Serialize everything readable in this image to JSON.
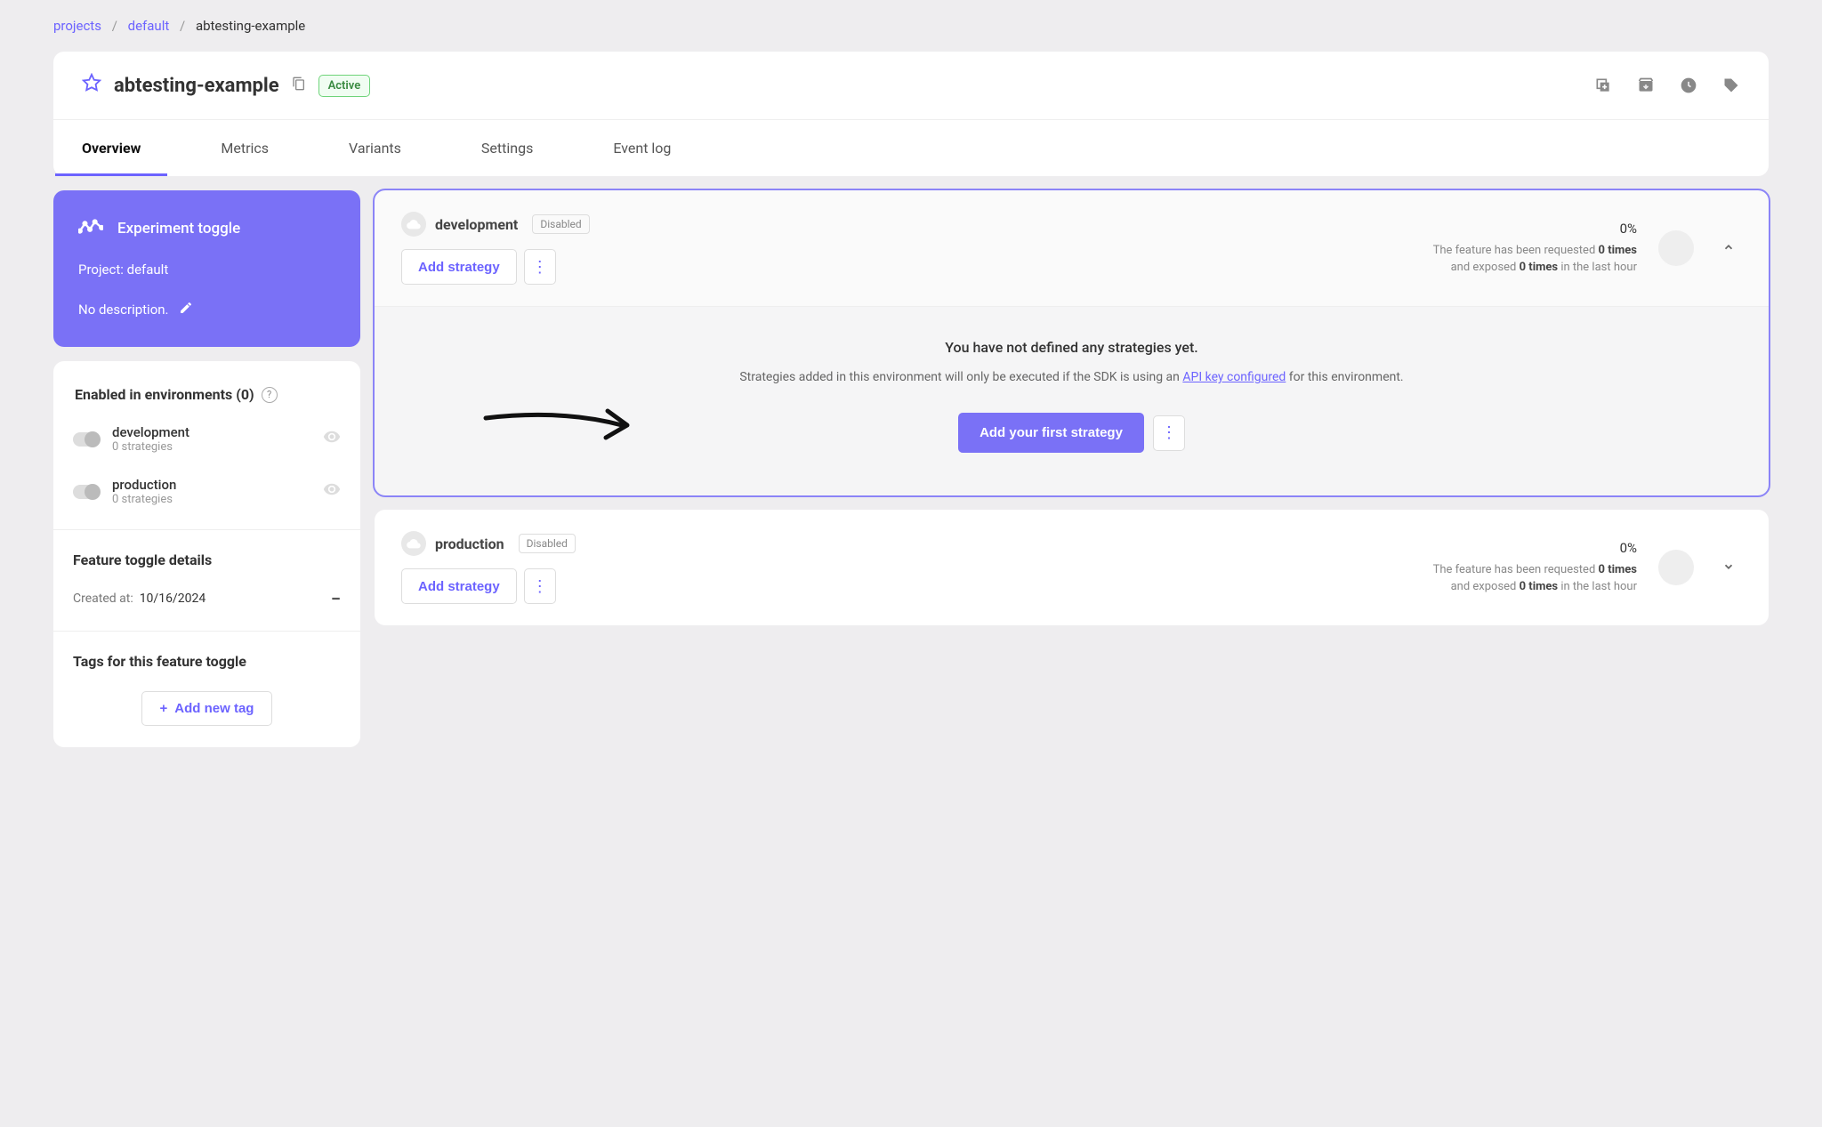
{
  "breadcrumb": {
    "projects": "projects",
    "project": "default",
    "feature": "abtesting-example"
  },
  "header": {
    "title": "abtesting-example",
    "status": "Active"
  },
  "tabs": [
    {
      "label": "Overview"
    },
    {
      "label": "Metrics"
    },
    {
      "label": "Variants"
    },
    {
      "label": "Settings"
    },
    {
      "label": "Event log"
    }
  ],
  "info": {
    "type": "Experiment toggle",
    "project_prefix": "Project: ",
    "project": "default",
    "description": "No description."
  },
  "env_summary": {
    "heading_prefix": "Enabled in environments (",
    "count": "0",
    "heading_suffix": ")",
    "items": [
      {
        "name": "development",
        "sub": "0 strategies"
      },
      {
        "name": "production",
        "sub": "0 strategies"
      }
    ]
  },
  "details": {
    "heading": "Feature toggle details",
    "created_label": "Created at:",
    "created_value": "10/16/2024"
  },
  "tags": {
    "heading": "Tags for this feature toggle",
    "button": "Add new tag"
  },
  "environments": [
    {
      "name": "development",
      "status": "Disabled",
      "add_label": "Add strategy",
      "pct": "0%",
      "line1_a": "The feature has been requested ",
      "line1_b": "0 times",
      "line2_a": "and exposed ",
      "line2_b": "0 times",
      "line2_c": " in the last hour",
      "expanded": true
    },
    {
      "name": "production",
      "status": "Disabled",
      "add_label": "Add strategy",
      "pct": "0%",
      "line1_a": "The feature has been requested ",
      "line1_b": "0 times",
      "line2_a": "and exposed ",
      "line2_b": "0 times",
      "line2_c": " in the last hour",
      "expanded": false
    }
  ],
  "strategy_body": {
    "title": "You have not defined any strategies yet.",
    "text_a": "Strategies added in this environment will only be executed if the SDK is using an ",
    "link": "API key configured",
    "text_b": " for this environment.",
    "cta": "Add your first strategy"
  }
}
